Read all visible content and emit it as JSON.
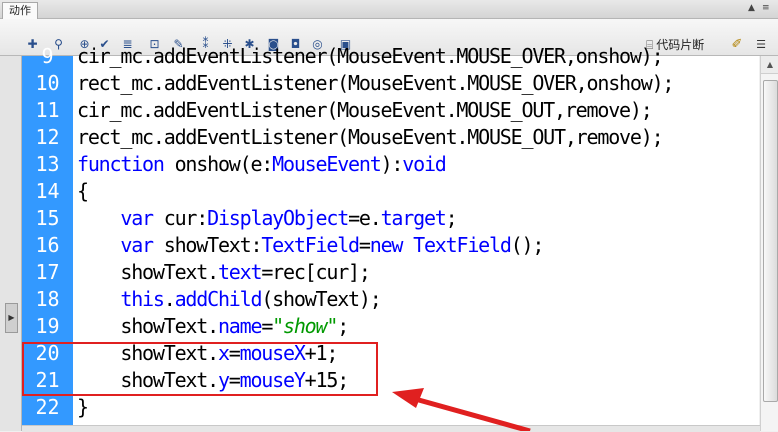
{
  "panel": {
    "tab_label": "动作",
    "collapse_icon": "double-chevron-up-icon",
    "options_icon": "menu-icon"
  },
  "toolbar": {
    "tools": [
      "add-statement-icon",
      "find-icon",
      "insert-target-path-icon",
      "check-syntax-icon",
      "auto-format-icon",
      "show-code-hint-icon",
      "debug-options-icon",
      "collapse-between-braces-icon",
      "collapse-selection-icon",
      "expand-all-icon",
      "apply-block-comment-icon",
      "apply-line-comment-icon",
      "remove-comment-icon",
      "show-hide-toolbox-icon"
    ],
    "snippets_label": "代码片断",
    "assistant_icon": "script-assist-wand-icon"
  },
  "editor": {
    "lines": [
      {
        "num": "9",
        "code": "cir_mc.addEventListener(MouseEvent.MOUSE_OVER,onshow);"
      },
      {
        "num": "10",
        "code": "rect_mc.addEventListener(MouseEvent.MOUSE_OVER,onshow);"
      },
      {
        "num": "11",
        "code": "cir_mc.addEventListener(MouseEvent.MOUSE_OUT,remove);"
      },
      {
        "num": "12",
        "code": "rect_mc.addEventListener(MouseEvent.MOUSE_OUT,remove);"
      },
      {
        "num": "13",
        "code": "function onshow(e:MouseEvent):void"
      },
      {
        "num": "14",
        "code": "{"
      },
      {
        "num": "15",
        "code": "    var cur:DisplayObject=e.target;"
      },
      {
        "num": "16",
        "code": "    var showText:TextField=new TextField();"
      },
      {
        "num": "17",
        "code": "    showText.text=rec[cur];"
      },
      {
        "num": "18",
        "code": "    this.addChild(showText);"
      },
      {
        "num": "19",
        "code": "    showText.name=\"show\";"
      },
      {
        "num": "20",
        "code": "    showText.x=mouseX+1;"
      },
      {
        "num": "21",
        "code": "    showText.y=mouseY+15;"
      },
      {
        "num": "22",
        "code": "}"
      }
    ]
  },
  "annotation": {
    "highlight_lines": [
      "20",
      "21"
    ],
    "color": "#e02020"
  },
  "colors": {
    "gutter": "#3399ff",
    "keyword": "#0000ff",
    "string": "#009900"
  }
}
